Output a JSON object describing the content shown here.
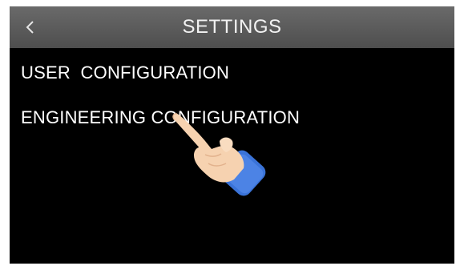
{
  "header": {
    "title": "SETTINGS",
    "back_icon": "chevron-left-icon"
  },
  "menu": {
    "items": [
      {
        "label": "USER  CONFIGURATION"
      },
      {
        "label": "ENGINEERING CONFIGURATION"
      }
    ]
  },
  "overlay": {
    "icon": "pointing-hand-icon"
  },
  "colors": {
    "background": "#000000",
    "header": "#5a5a5a",
    "text": "#ffffff",
    "hand_skin": "#f6d2b0",
    "sleeve": "#3a73d8"
  }
}
